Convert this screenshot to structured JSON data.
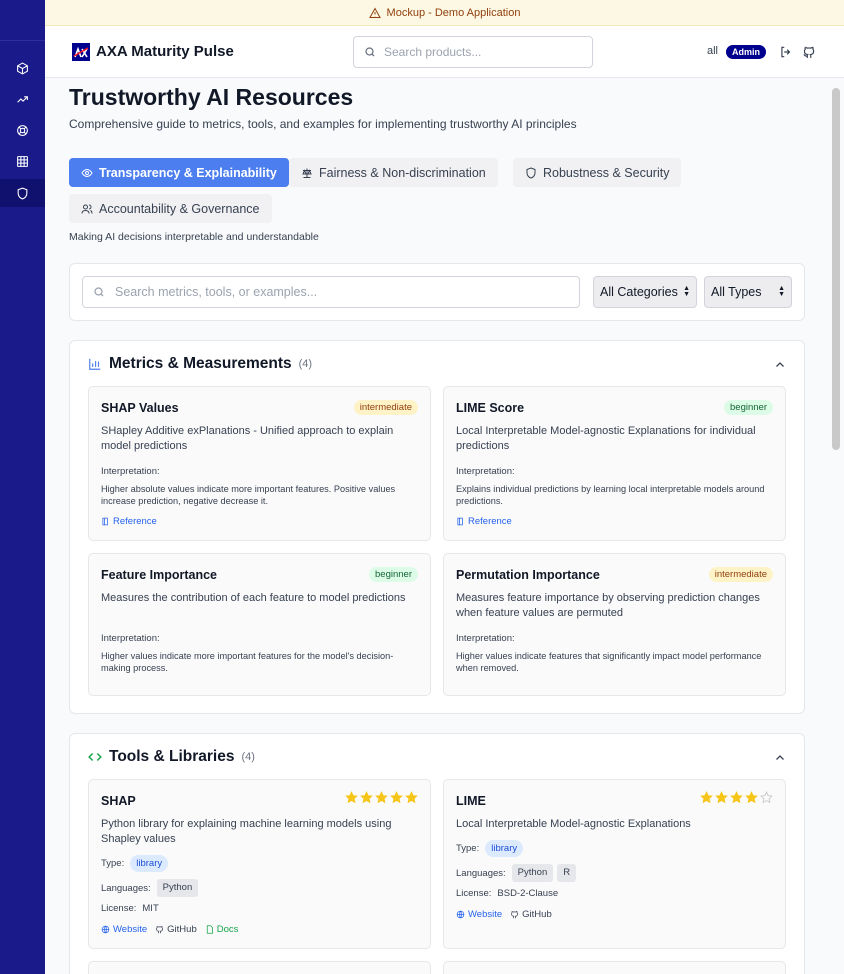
{
  "banner": {
    "text": "Mockup - Demo Application",
    "icon": "warning-triangle-icon"
  },
  "header": {
    "app_title": "AXA Maturity Pulse",
    "search_placeholder": "Search products...",
    "user_scope": "all",
    "role_badge": "Admin",
    "icons": [
      "logout-icon",
      "github-icon"
    ]
  },
  "sidebar": {
    "items": [
      {
        "icon": "cube-icon",
        "active": false
      },
      {
        "icon": "trending-up-icon",
        "active": false
      },
      {
        "icon": "lifebuoy-icon",
        "active": false
      },
      {
        "icon": "grid-icon",
        "active": false
      },
      {
        "icon": "shield-icon",
        "active": true
      }
    ]
  },
  "page": {
    "title": "Trustworthy AI Resources",
    "subtitle": "Comprehensive guide to metrics, tools, and examples for implementing trustworthy AI principles",
    "tabs": [
      {
        "label": "Transparency & Explainability",
        "icon": "eye-icon",
        "active": true
      },
      {
        "label": "Fairness & Non-discrimination",
        "icon": "scale-icon",
        "active": false
      },
      {
        "label": "Robustness & Security",
        "icon": "shield-icon",
        "active": false
      },
      {
        "label": "Accountability & Governance",
        "icon": "users-icon",
        "active": false
      }
    ],
    "tab_description": "Making AI decisions interpretable and understandable"
  },
  "filters": {
    "search_placeholder": "Search metrics, tools, or examples...",
    "category_select": "All Categories",
    "type_select": "All Types"
  },
  "metrics": {
    "title": "Metrics & Measurements",
    "count": "(4)",
    "interpretation_label": "Interpretation:",
    "reference_label": "Reference",
    "cards": [
      {
        "name": "SHAP Values",
        "level": "intermediate",
        "description": "SHapley Additive exPlanations - Unified approach to explain model predictions",
        "interpretation": "Higher absolute values indicate more important features. Positive values increase prediction, negative decrease it.",
        "has_reference": true
      },
      {
        "name": "LIME Score",
        "level": "beginner",
        "description": "Local Interpretable Model-agnostic Explanations for individual predictions",
        "interpretation": "Explains individual predictions by learning local interpretable models around predictions.",
        "has_reference": true
      },
      {
        "name": "Feature Importance",
        "level": "beginner",
        "description": "Measures the contribution of each feature to model predictions",
        "interpretation": "Higher values indicate more important features for the model's decision-making process.",
        "has_reference": false
      },
      {
        "name": "Permutation Importance",
        "level": "intermediate",
        "description": "Measures feature importance by observing prediction changes when feature values are permuted",
        "interpretation": "Higher values indicate features that significantly impact model performance when removed.",
        "has_reference": false
      }
    ]
  },
  "tools": {
    "title": "Tools & Libraries",
    "count": "(4)",
    "type_label": "Type:",
    "languages_label": "Languages:",
    "license_label": "License:",
    "cards": [
      {
        "name": "SHAP",
        "rating": 5,
        "description": "Python library for explaining machine learning models using Shapley values",
        "type": "library",
        "languages": [
          "Python"
        ],
        "license": "MIT",
        "links": [
          "Website",
          "GitHub",
          "Docs"
        ]
      },
      {
        "name": "LIME",
        "rating": 4,
        "description": "Local Interpretable Model-agnostic Explanations",
        "type": "library",
        "languages": [
          "Python",
          "R"
        ],
        "license": "BSD-2-Clause",
        "links": [
          "Website",
          "GitHub"
        ]
      }
    ]
  },
  "colors": {
    "sidebar": "#1a1a8a",
    "brand": "#00008f",
    "active_tab": "#4c7ef0",
    "star": "#f5c518"
  }
}
